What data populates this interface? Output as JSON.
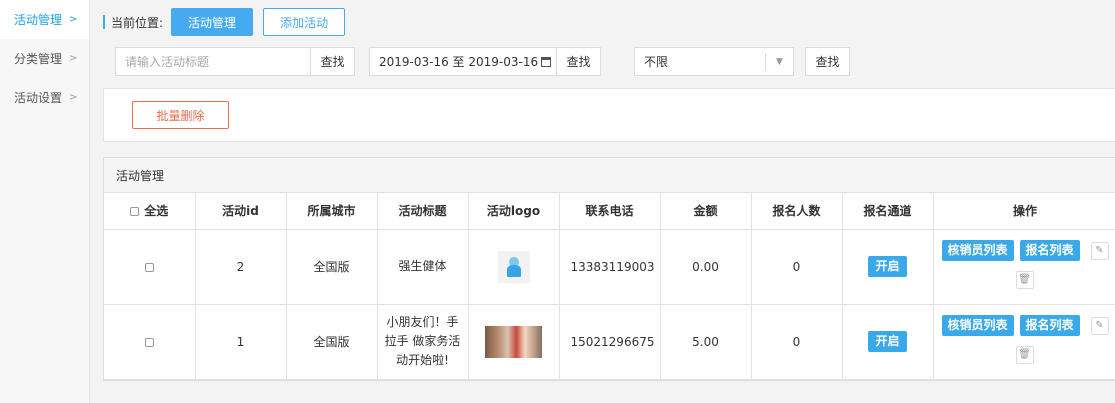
{
  "sidebar": {
    "items": [
      {
        "label": "活动管理",
        "active": true
      },
      {
        "label": "分类管理",
        "active": false
      },
      {
        "label": "活动设置",
        "active": false
      }
    ]
  },
  "breadcrumb": {
    "label": "当前位置:",
    "current": "活动管理",
    "add_button": "添加活动"
  },
  "filters": {
    "title_placeholder": "请输入活动标题",
    "search1": "查找",
    "date_range": "2019-03-16 至 2019-03-16",
    "search2": "查找",
    "select_value": "不限",
    "search3": "查找"
  },
  "actions": {
    "batch_delete": "批量删除"
  },
  "panel": {
    "title": "活动管理",
    "columns": [
      "全选",
      "活动id",
      "所属城市",
      "活动标题",
      "活动logo",
      "联系电话",
      "金额",
      "报名人数",
      "报名通道",
      "操作"
    ],
    "rows": [
      {
        "id": "2",
        "city": "全国版",
        "title": "强生健体",
        "tel": "13383119003",
        "amount": "0.00",
        "count": "0",
        "channel": "开启",
        "op1": "核销员列表",
        "op2": "报名列表"
      },
      {
        "id": "1",
        "city": "全国版",
        "title": "小朋友们！手拉手 做家务活动开始啦!",
        "tel": "15021296675",
        "amount": "5.00",
        "count": "0",
        "channel": "开启",
        "op1": "核销员列表",
        "op2": "报名列表"
      }
    ]
  },
  "colors": {
    "accent": "#47a9ef",
    "danger": "#e86e4b"
  },
  "icons": [
    "chevron-right-icon",
    "calendar-icon",
    "dropdown-arrow-icon",
    "pencil-icon",
    "trash-icon"
  ]
}
